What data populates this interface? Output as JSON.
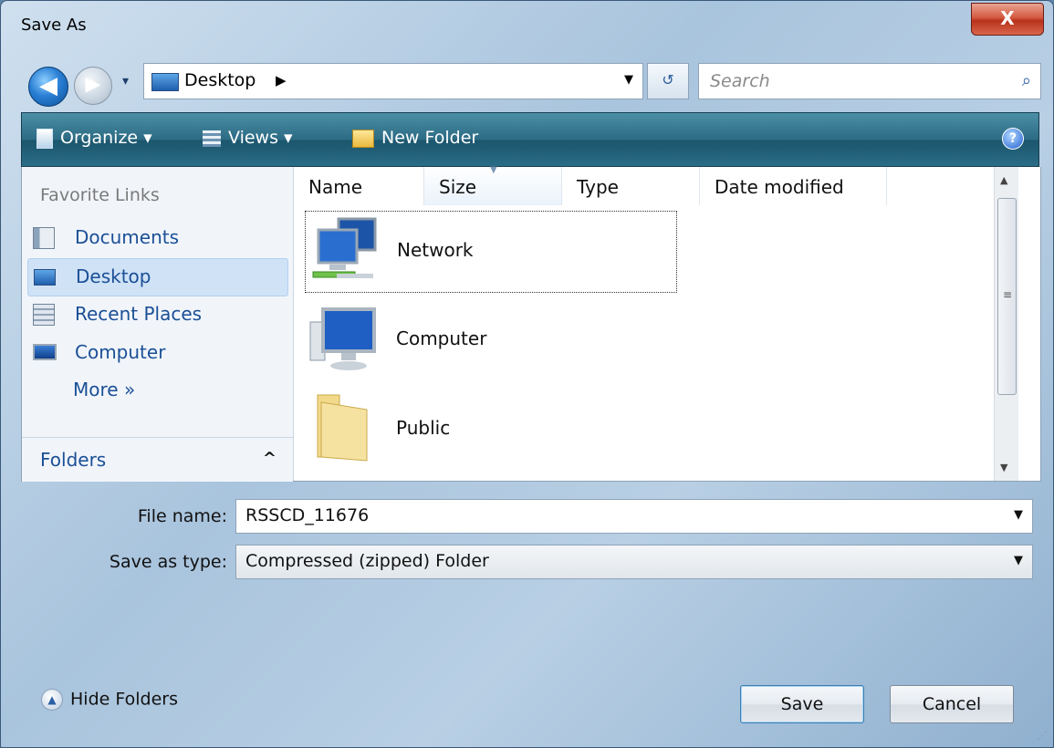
{
  "window": {
    "title": "Save As",
    "close_glyph": "X"
  },
  "address_bar": {
    "location": "Desktop",
    "separator": "▶",
    "dropdown": "▼",
    "refresh_glyph": "↺",
    "back_glyph": "◀",
    "fwd_glyph": "▶",
    "recent_glyph": "▾",
    "search_placeholder": "Search",
    "search_icon": "⌕"
  },
  "toolbar": {
    "organize_label": "Organize ▾",
    "views_label": "Views ▾",
    "new_folder_label": "New Folder",
    "help_glyph": "?"
  },
  "nav_pane": {
    "header": "Favorite Links",
    "items": [
      {
        "label": "Documents",
        "icon": "documents-icon"
      },
      {
        "label": "Desktop",
        "icon": "desktop-icon",
        "selected": true
      },
      {
        "label": "Recent Places",
        "icon": "recent-places-icon"
      },
      {
        "label": "Computer",
        "icon": "computer-icon"
      }
    ],
    "more_label": "More »",
    "folders_label": "Folders",
    "folders_chevron": "^"
  },
  "file_list": {
    "columns": [
      "Name",
      "Size",
      "Type",
      "Date modified"
    ],
    "sorted_column": "Size",
    "items": [
      {
        "label": "Network",
        "icon": "network-icon",
        "focused": true
      },
      {
        "label": "Computer",
        "icon": "computer-icon"
      },
      {
        "label": "Public",
        "icon": "folder-icon"
      }
    ]
  },
  "scrollbar": {
    "up": "▲",
    "down": "▼",
    "grip": "≡"
  },
  "form": {
    "file_name_label": "File name:",
    "file_name_value": "RSSCD_11676",
    "save_as_type_label": "Save as type:",
    "save_as_type_value": "Compressed (zipped) Folder",
    "dropdown_glyph": "▼"
  },
  "footer": {
    "hide_folders_label": "Hide Folders",
    "hide_folders_glyph": "▲",
    "save_label": "Save",
    "cancel_label": "Cancel",
    "resize_glyph": "⋰"
  },
  "colors": {
    "accent": "#1b4f96",
    "toolbar": "#2c6b84",
    "close": "#c8402a"
  }
}
